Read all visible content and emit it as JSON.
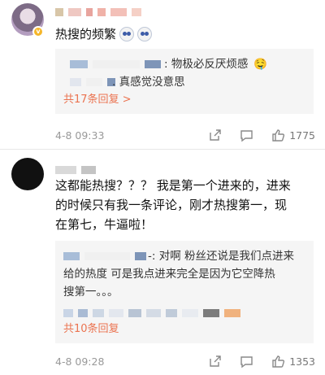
{
  "comments": [
    {
      "text": "热搜的频繁",
      "replies": [
        {
          "text": ": 物极必反厌烦感"
        },
        {
          "text": ". 真感觉没意思"
        }
      ],
      "more_label": "共17条回复 >",
      "time": "4-8 09:33",
      "like_count": "1775"
    },
    {
      "text_lines": [
        "这都能热搜？？？ 我是第一个进来的，进来",
        "的时候只有我一条评论，刚才热搜第一，现",
        "在第七，牛逼啦！"
      ],
      "reply_lines": [
        "-: 对啊 粉丝还说是我们点进来",
        "给的热度 可是我点进来完全是因为它空降热",
        "搜第一。。。"
      ],
      "more_label": "共10条回复",
      "time": "4-8 09:28",
      "like_count": "1353"
    }
  ],
  "colors": {
    "accent": "#eb7350",
    "meta": "#999999",
    "reply_bg": "#f5f5f5"
  },
  "icons": [
    "share-icon",
    "comment-icon",
    "like-icon",
    "verified-badge-icon"
  ]
}
